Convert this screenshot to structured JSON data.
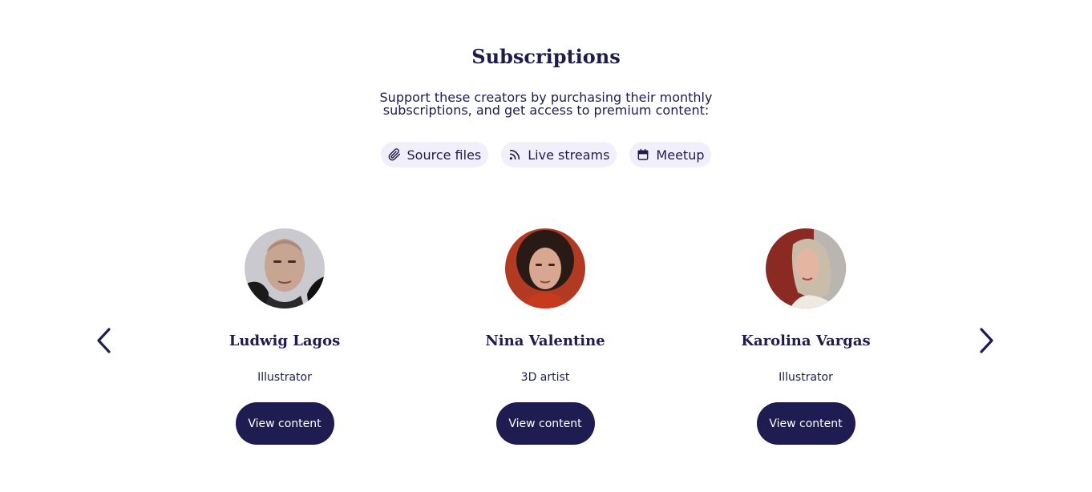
{
  "header": {
    "title": "Subscriptions",
    "subtitle": "Support these creators by purchasing their monthly subscriptions, and get access to premium content:"
  },
  "features": [
    {
      "label": "Source files",
      "icon": "paperclip-icon"
    },
    {
      "label": "Live streams",
      "icon": "rss-icon"
    },
    {
      "label": "Meetup",
      "icon": "calendar-icon"
    }
  ],
  "creators": [
    {
      "name": "Ludwig Lagos",
      "role": "Illustrator",
      "button": "View content"
    },
    {
      "name": "Nina Valentine",
      "role": "3D artist",
      "button": "View content"
    },
    {
      "name": "Karolina Vargas",
      "role": "Illustrator",
      "button": "View content"
    }
  ],
  "carousel": {
    "prev_icon": "chevron-left-icon",
    "next_icon": "chevron-right-icon"
  },
  "colors": {
    "primary": "#1f1c52",
    "chip_background": "#f1f0fa",
    "text": "#1f1c4d"
  }
}
